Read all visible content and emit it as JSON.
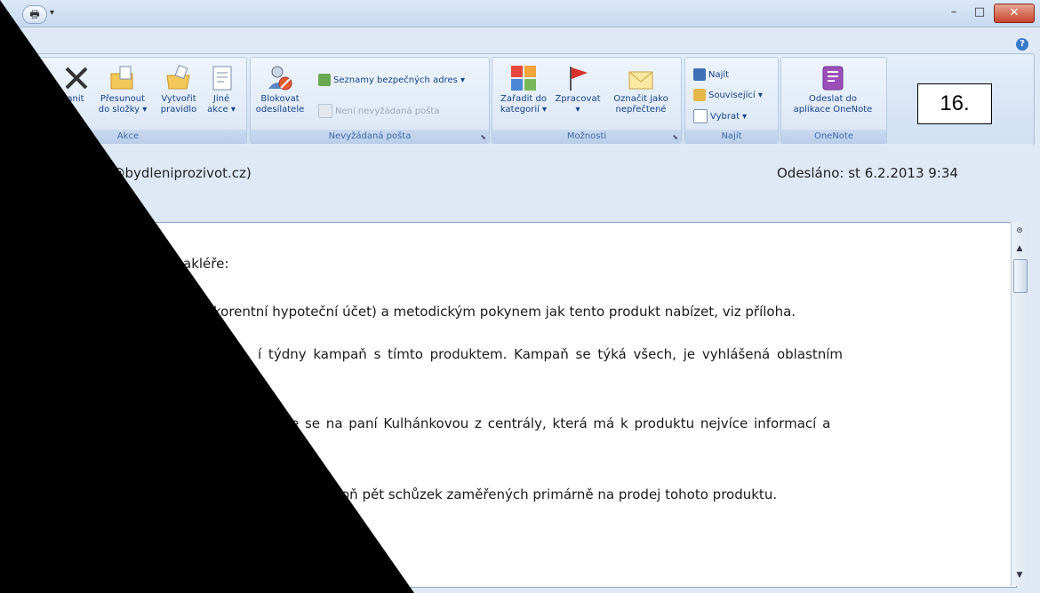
{
  "window": {
    "quick_access_arrow": "▾",
    "minimize": "–",
    "maximize": "□",
    "close": "✕",
    "help": "?"
  },
  "ribbon": {
    "groups": {
      "akce": {
        "label": "Akce",
        "buttons": {
          "delete_partial": "anit",
          "move_line1": "Přesunout",
          "move_line2": "do složky ▾",
          "rule_line1": "Vytvořit",
          "rule_line2": "pravidlo",
          "other_line1": "Jiné",
          "other_line2": "akce ▾"
        }
      },
      "junk": {
        "label": "Nevyžádaná pošta",
        "block_line1": "Blokovat",
        "block_line2": "odesílatele",
        "safe_lists": "Seznamy bezpečných adres ▾",
        "not_junk": "Není nevyžádaná pošta"
      },
      "options": {
        "label": "Možnosti",
        "categorize_line1": "Zařadit do",
        "categorize_line2": "kategorií ▾",
        "followup_line1": "Zpracovat",
        "followup_line2": "▾",
        "unread_line1": "Označit jako",
        "unread_line2": "nepřečtené"
      },
      "find": {
        "label": "Najít",
        "find": "Najít",
        "related": "Související ▾",
        "select": "Vybrat ▾"
      },
      "onenote": {
        "label": "OneNote",
        "send_line1": "Odeslat do",
        "send_line2": "aplikace OneNote"
      }
    }
  },
  "annotation_label": "16.",
  "message": {
    "sender_partial": "n@bydleniprozivot.cz)",
    "sent": "Odesláno: st 6.2.2013 9:34",
    "body_lines": [
      "akléře:",
      "korentní hypoteční účet) a metodickým pokynem jak tento produkt nabízet, viz příloha.",
      "í týdny kampaň s tímto produktem. Kampaň se týká všech, je vyhlášená oblastním",
      "e se na paní Kulhánkovou z centrály, která má k produktu nejvíce informací a",
      "oň pět schůzek zaměřených primárně na prodej tohoto produktu."
    ]
  },
  "colors": {
    "ribbon_text": "#15428b",
    "mask": "#000000"
  }
}
